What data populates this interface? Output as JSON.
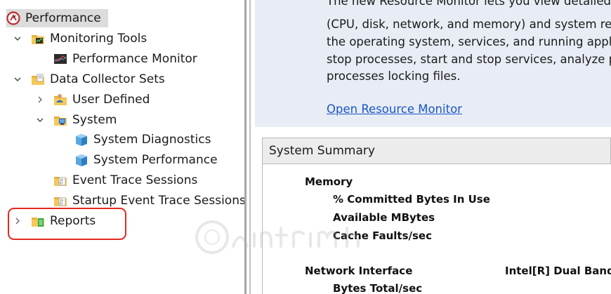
{
  "tree": {
    "items": [
      {
        "label": "Performance",
        "icon": "performance-icon",
        "expand": "none",
        "selected": true
      },
      {
        "label": "Monitoring Tools",
        "icon": "folder-monitor-icon",
        "expand": "expanded"
      },
      {
        "label": "Performance Monitor",
        "icon": "performance-monitor-icon",
        "expand": "none"
      },
      {
        "label": "Data Collector Sets",
        "icon": "folder-data-icon",
        "expand": "expanded"
      },
      {
        "label": "User Defined",
        "icon": "user-defined-icon",
        "expand": "collapsed"
      },
      {
        "label": "System",
        "icon": "system-folder-icon",
        "expand": "expanded"
      },
      {
        "label": "System Diagnostics",
        "icon": "data-collector-set-icon",
        "expand": "none"
      },
      {
        "label": "System Performance",
        "icon": "data-collector-set-icon",
        "expand": "none"
      },
      {
        "label": "Event Trace Sessions",
        "icon": "trace-sessions-icon",
        "expand": "none"
      },
      {
        "label": "Startup Event Trace Sessions",
        "icon": "trace-sessions-icon",
        "expand": "none"
      },
      {
        "label": "Reports",
        "icon": "folder-reports-icon",
        "expand": "collapsed",
        "highlighted": true
      }
    ]
  },
  "description": {
    "lines": [
      "The new Resource Monitor lets you view detailed",
      "(CPU, disk, network, and memory) and system re",
      "the operating system, services, and running appl",
      "stop processes, start and stop services, analyze p",
      "processes locking files."
    ],
    "link": "Open Resource Monitor"
  },
  "summary": {
    "header": "System Summary",
    "rows": [
      {
        "label": "Memory",
        "level": 0,
        "value": ""
      },
      {
        "label": "% Committed Bytes In Use",
        "level": 1,
        "value": ""
      },
      {
        "label": "Available MBytes",
        "level": 1,
        "value": ""
      },
      {
        "label": "Cache Faults/sec",
        "level": 1,
        "value": ""
      },
      {
        "label": "Network Interface",
        "level": 0,
        "value": "Intel[R] Dual Band"
      },
      {
        "label": "Bytes Total/sec",
        "level": 1,
        "value": ""
      }
    ]
  },
  "colors": {
    "selection": "#dcdcdc",
    "highlight_box": "#e4281f",
    "link": "#1a55c8",
    "description_bg": "#e8edf5"
  }
}
